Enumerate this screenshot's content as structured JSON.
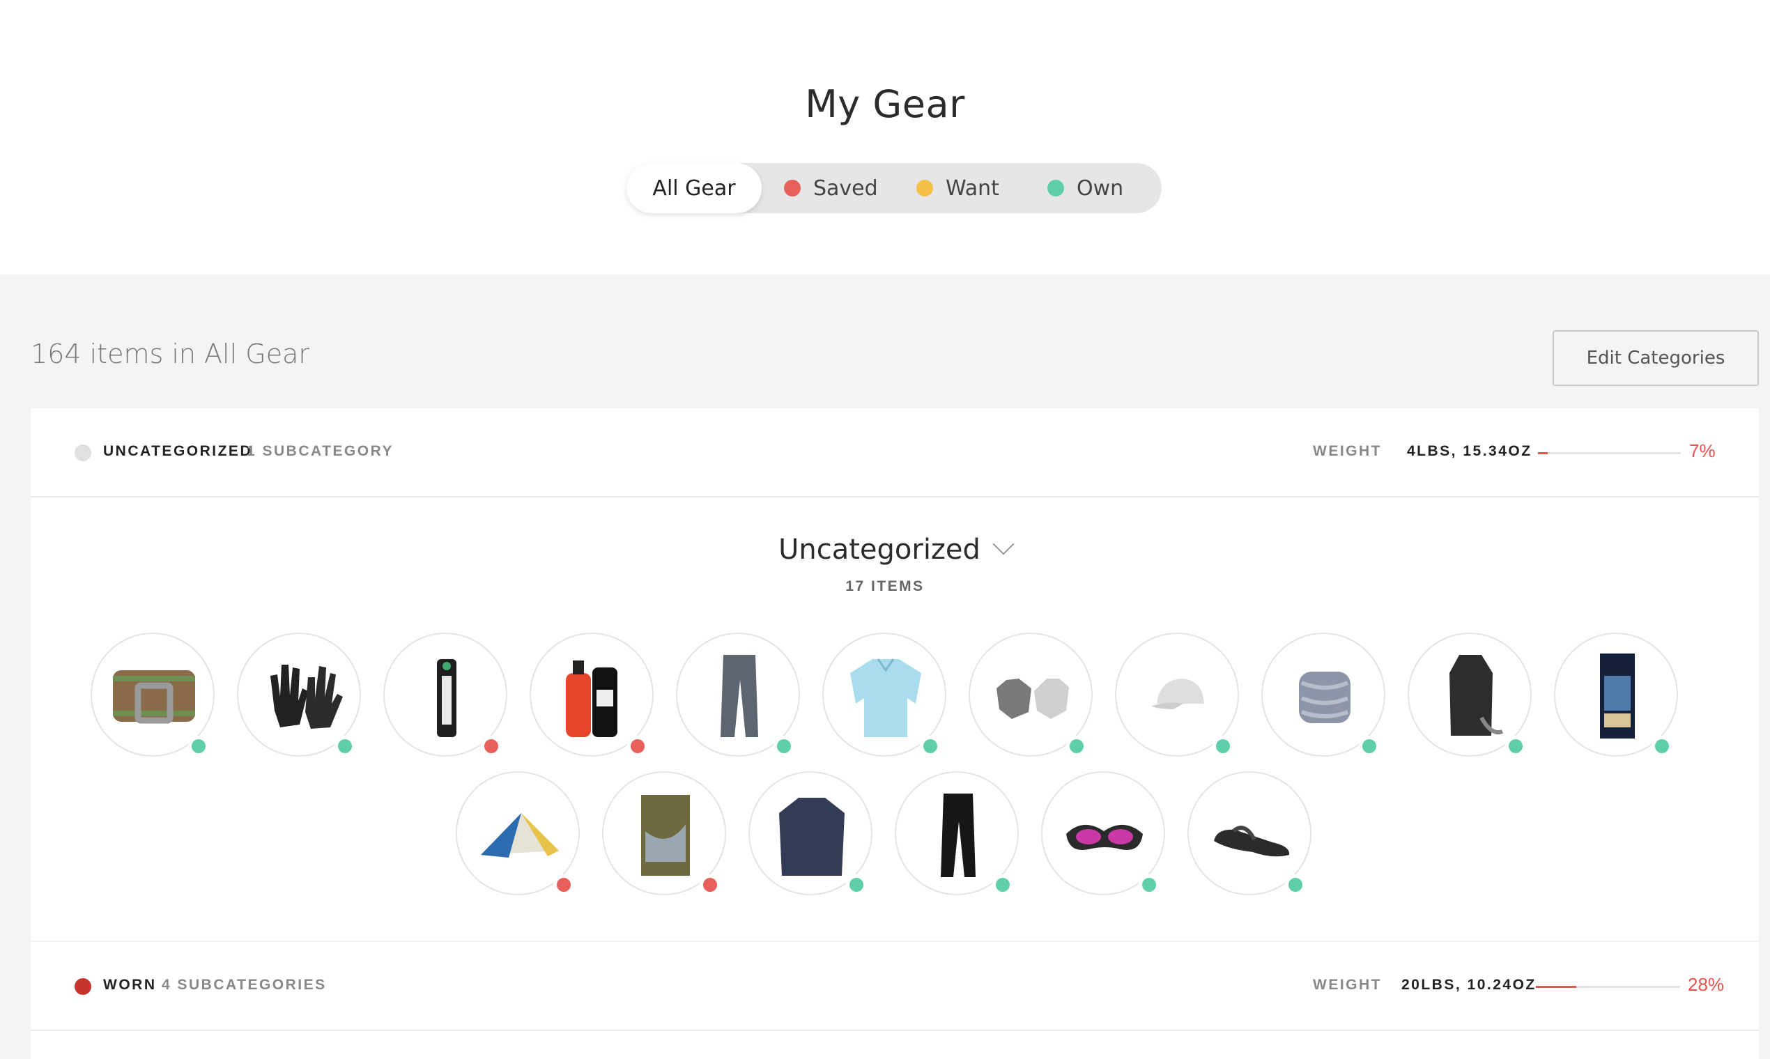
{
  "header": {
    "title": "My Gear"
  },
  "filters": [
    {
      "label": "All Gear",
      "active": true
    },
    {
      "label": "Saved",
      "color": "#e8605c"
    },
    {
      "label": "Want",
      "color": "#f5c04a"
    },
    {
      "label": "Own",
      "color": "#5fcfa9"
    }
  ],
  "summary": {
    "count_text": "164 items in All Gear",
    "edit_label": "Edit Categories"
  },
  "categories": [
    {
      "name": "UNCATEGORIZED",
      "sub": "1 SUBCATEGORY",
      "dot_color": "#e0e0e0",
      "weight_label": "WEIGHT",
      "weight": "4LBS, 15.34OZ",
      "percent": "7%",
      "percent_value": 0.07
    },
    {
      "name": "WORN",
      "sub": "4 SUBCATEGORIES",
      "dot_color": "#c6322c",
      "weight_label": "WEIGHT",
      "weight": "20LBS, 10.24OZ",
      "percent": "28%",
      "percent_value": 0.28
    }
  ],
  "subcategory": {
    "title": "Uncategorized",
    "count": "17 ITEMS"
  },
  "status_colors": {
    "own": "#5fcfa9",
    "saved": "#e8605c"
  },
  "items": [
    {
      "icon": "belt-icon",
      "status": "own"
    },
    {
      "icon": "gloves-icon",
      "status": "own"
    },
    {
      "icon": "filter-straw-icon",
      "status": "saved"
    },
    {
      "icon": "bear-spray-icon",
      "status": "saved"
    },
    {
      "icon": "pants-icon",
      "status": "own"
    },
    {
      "icon": "shirt-icon",
      "status": "own"
    },
    {
      "icon": "fingerless-gloves-icon",
      "status": "own"
    },
    {
      "icon": "cap-icon",
      "status": "own"
    },
    {
      "icon": "neck-gaiter-icon",
      "status": "own"
    },
    {
      "icon": "jacket-icon",
      "status": "own"
    },
    {
      "icon": "book-icon",
      "status": "own"
    },
    {
      "icon": "tent-icon",
      "status": "saved"
    },
    {
      "icon": "hammock-photo-icon",
      "status": "saved"
    },
    {
      "icon": "hoodie-icon",
      "status": "own"
    },
    {
      "icon": "leggings-icon",
      "status": "own"
    },
    {
      "icon": "eye-mask-icon",
      "status": "own"
    },
    {
      "icon": "sandal-icon",
      "status": "own"
    }
  ]
}
